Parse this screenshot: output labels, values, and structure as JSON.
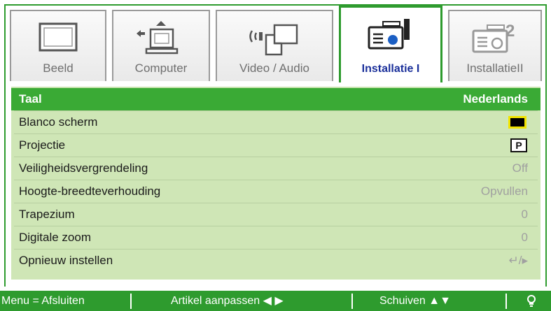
{
  "tabs": [
    {
      "label": "Beeld",
      "icon": "monitor-icon"
    },
    {
      "label": "Computer",
      "icon": "computer-icon"
    },
    {
      "label": "Video / Audio",
      "icon": "video-audio-icon"
    },
    {
      "label": "Installatie I",
      "icon": "projector-1-icon",
      "active": true
    },
    {
      "label": "Installatie II",
      "icon": "projector-2-icon"
    }
  ],
  "tab_labels_visible": [
    "Beeld",
    "Computer",
    "Video / Audio",
    "Installatie I",
    "InstallatieII"
  ],
  "menu": {
    "items": [
      {
        "name": "Taal",
        "value": "Nederlands",
        "selected": true
      },
      {
        "name": "Blanco scherm",
        "value": "",
        "icon": "blank-screen-icon"
      },
      {
        "name": "Projectie",
        "value": "P",
        "icon": "projection-icon"
      },
      {
        "name": "Veiligheidsvergrendeling",
        "value": "Off"
      },
      {
        "name": "Hoogte-breedteverhouding",
        "value": "Opvullen"
      },
      {
        "name": "Trapezium",
        "value": "0"
      },
      {
        "name": "Digitale zoom",
        "value": "0"
      },
      {
        "name": "Opnieuw instellen",
        "value": "↵/▸"
      }
    ]
  },
  "footer": {
    "exit": "Menu = Afsluiten",
    "adjust": "Artikel aanpassen ◀ ▶",
    "scroll": "Schuiven ▲▼",
    "lamp_icon": "lightbulb-icon"
  },
  "colors": {
    "accent": "#2e9b2e",
    "selected_row": "#3aaa35",
    "menu_bg": "#cfe6b6",
    "active_tab_text": "#1a2f9a"
  }
}
